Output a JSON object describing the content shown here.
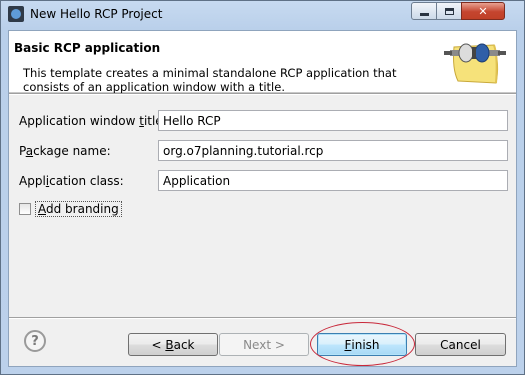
{
  "window": {
    "title": "New Hello RCP Project",
    "controls": {
      "minimize": "minimize-icon",
      "maximize": "maximize-icon",
      "close": "close-icon"
    }
  },
  "banner": {
    "title": "Basic RCP application",
    "description": "This template creates a minimal standalone RCP application that consists of an application window with a title.",
    "image_icon": "plugin-connector-icon"
  },
  "form": {
    "fields": [
      {
        "label_before": "Application window ",
        "label_mnemonic": "t",
        "label_after": "itle:",
        "value": "Hello RCP"
      },
      {
        "label_before": "P",
        "label_mnemonic": "a",
        "label_after": "ckage name:",
        "value": "org.o7planning.tutorial.rcp"
      },
      {
        "label_before": "Appl",
        "label_mnemonic": "i",
        "label_after": "cation class:",
        "value": "Application"
      }
    ],
    "branding": {
      "label_before": "",
      "label_mnemonic": "A",
      "label_after": "dd branding",
      "checked": false
    }
  },
  "buttons": {
    "help_icon": "help-icon",
    "help_glyph": "?",
    "back": {
      "prefix": "< ",
      "mnemonic": "B",
      "rest": "ack"
    },
    "next": {
      "label": "Next >"
    },
    "finish": {
      "mnemonic": "F",
      "rest": "inish"
    },
    "cancel": {
      "label": "Cancel"
    }
  },
  "colors": {
    "finish_highlight": "#c8283a",
    "title_gradient_top": "#c7daf0"
  }
}
